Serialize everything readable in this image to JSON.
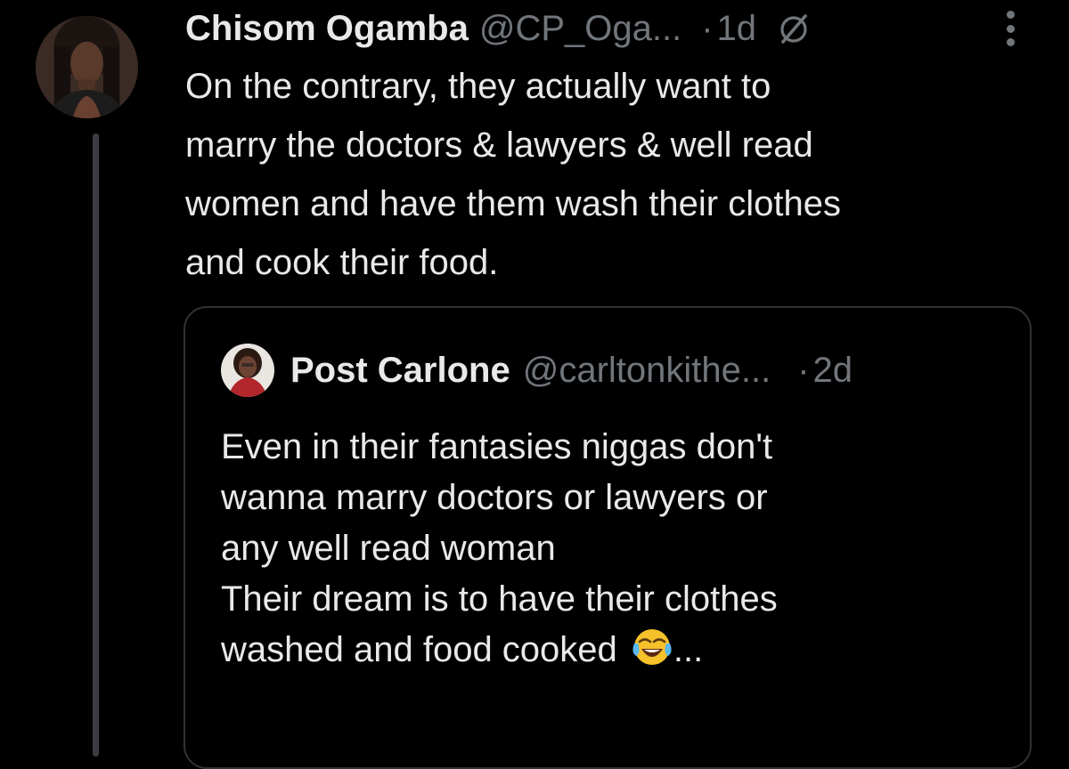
{
  "tweet": {
    "author": {
      "display_name": "Chisom Ogamba",
      "handle": "@CP_Oga...",
      "avatar_icon": "profile-photo"
    },
    "separator": "·",
    "time": "1d",
    "grok_icon": "grok-icon",
    "more_icon": "more-options-icon",
    "text_lines": [
      "On the contrary, they actually want to",
      "marry the doctors & lawyers & well read",
      "women and have them wash their clothes",
      "and cook their food."
    ]
  },
  "quote": {
    "author": {
      "display_name": "Post Carlone",
      "handle": "@carltonkithe...",
      "avatar_icon": "profile-photo"
    },
    "separator": "·",
    "time": "2d",
    "text_lines": [
      "Even in their fantasies niggas don't",
      "wanna marry doctors or lawyers or",
      "any well read woman",
      "Their dream is to have their clothes",
      "washed and food cooked"
    ],
    "trailing_emoji": "face-with-tears-of-joy",
    "truncation": "..."
  },
  "colors": {
    "background": "#000000",
    "primary_text": "#e7e9ea",
    "secondary_text": "#71767b",
    "border": "#2f3336",
    "thread_line": "#3a3d41"
  }
}
